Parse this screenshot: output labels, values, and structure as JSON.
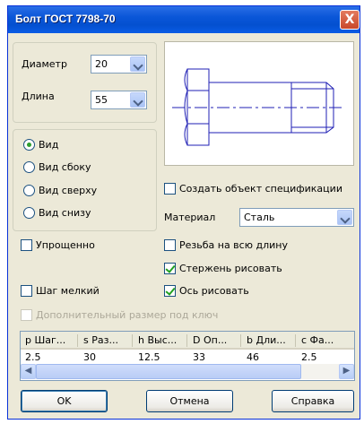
{
  "window": {
    "title": "Болт ГОСТ 7798-70",
    "close_label": "X"
  },
  "diameter": {
    "label": "Диаметр",
    "value": "20"
  },
  "length": {
    "label": "Длина",
    "value": "55"
  },
  "views": [
    {
      "label": "Вид",
      "selected": true
    },
    {
      "label": "Вид сбоку",
      "selected": false
    },
    {
      "label": "Вид сверху",
      "selected": false
    },
    {
      "label": "Вид снизу",
      "selected": false
    }
  ],
  "create_spec": {
    "label": "Создать объект спецификации",
    "checked": false
  },
  "material": {
    "label": "Материал",
    "value": "Сталь"
  },
  "simplified": {
    "label": "Упрощенно",
    "checked": false
  },
  "full_thread": {
    "label": "Резьба на всю длину",
    "checked": false
  },
  "draw_shank": {
    "label": "Стержень рисовать",
    "checked": true
  },
  "fine_pitch": {
    "label": "Шаг мелкий",
    "checked": false
  },
  "draw_axis": {
    "label": "Ось рисовать",
    "checked": true
  },
  "extra_key": {
    "label": "Дополнительный размер под ключ",
    "checked": false,
    "disabled": true
  },
  "table": {
    "headers": [
      "p Шаг...",
      "s Раз...",
      "h Выс...",
      "D Оп...",
      "b Дли...",
      "c Фа..."
    ],
    "row": [
      "2.5",
      "30",
      "12.5",
      "33",
      "46",
      "2.5"
    ]
  },
  "buttons": {
    "ok": "OK",
    "cancel": "Отмена",
    "help": "Справка"
  },
  "colors": {
    "titlebar": "#0a56d8",
    "dialog_bg": "#ece9d8",
    "drawing_lines": "#1f1fb4"
  }
}
